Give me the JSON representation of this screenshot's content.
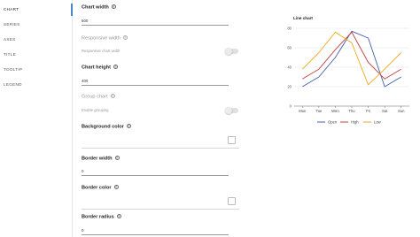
{
  "sidebar": {
    "items": [
      {
        "label": "CHART",
        "active": true
      },
      {
        "label": "SERIES",
        "active": false
      },
      {
        "label": "AXES",
        "active": false
      },
      {
        "label": "TITLE",
        "active": false
      },
      {
        "label": "TOOLTIP",
        "active": false
      },
      {
        "label": "LEGEND",
        "active": false
      }
    ]
  },
  "form": {
    "chart_width": {
      "label": "Chart width",
      "value": "600"
    },
    "responsive_width": {
      "label": "Responsive width",
      "toggle_label": "Responsive chart width",
      "enabled": false
    },
    "chart_height": {
      "label": "Chart height",
      "value": "400"
    },
    "group_chart": {
      "label": "Group chart",
      "toggle_label": "Enable grouping",
      "enabled": false
    },
    "background_color": {
      "label": "Background color",
      "value": "#ffffff"
    },
    "border_width": {
      "label": "Border width",
      "value": "0"
    },
    "border_color": {
      "label": "Border color",
      "value": "#ffffff"
    },
    "border_radius": {
      "label": "Border radius",
      "value": "0"
    }
  },
  "colors": {
    "accent": "#4a86c8",
    "series_open": "#3f5ea8",
    "series_high": "#c2403f",
    "series_low": "#f2a81d"
  },
  "chart_data": {
    "type": "line",
    "title": "Line chart",
    "categories": [
      "Mon",
      "Tue",
      "Wen",
      "Thu",
      "Fri",
      "Sat",
      "Sun"
    ],
    "series": [
      {
        "name": "Open",
        "values": [
          20,
          30,
          50,
          77,
          70,
          20,
          30
        ]
      },
      {
        "name": "High",
        "values": [
          28,
          38,
          58,
          76,
          45,
          28,
          38
        ]
      },
      {
        "name": "Low",
        "values": [
          38,
          55,
          76,
          65,
          22,
          38,
          55
        ]
      }
    ],
    "ylim": [
      0,
      80
    ],
    "yticks": [
      0,
      20,
      40,
      60,
      80
    ],
    "grid": true,
    "legend": "bottom"
  }
}
